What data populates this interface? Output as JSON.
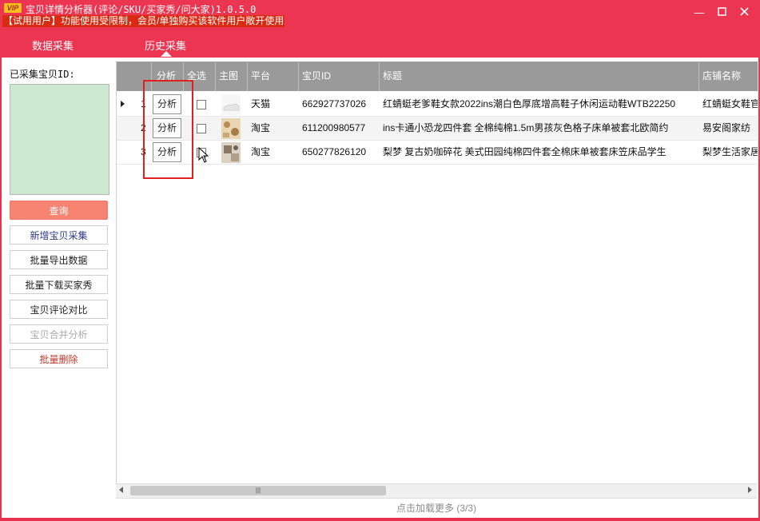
{
  "app": {
    "vip_badge": "VIP",
    "title": "宝贝详情分析器(评论/SKU/买家秀/问大家)1.0.5.0",
    "trial_notice": "【试用用户】功能使用受限制，会员/单独购买该软件用户敞开使用",
    "window_controls": [
      "minimize-icon",
      "maximize-icon",
      "close-icon"
    ]
  },
  "tabs": [
    {
      "label": "数据采集",
      "active": false
    },
    {
      "label": "历史采集",
      "active": true
    }
  ],
  "sidebar": {
    "collected_id_label": "已采集宝贝ID:",
    "buttons": {
      "query": "查询",
      "new_collect": "新增宝贝采集",
      "export": "批量导出数据",
      "download_shows": "批量下载买家秀",
      "compare": "宝贝评论对比",
      "merge": "宝贝合并分析",
      "delete": "批量删除"
    }
  },
  "table": {
    "columns": [
      "分析",
      "全选",
      "主图",
      "平台",
      "宝贝ID",
      "标题",
      "店铺名称"
    ],
    "rows": [
      {
        "num": "1",
        "action": "分析",
        "platform": "天猫",
        "id": "662927737026",
        "title": "红蜻蜓老爹鞋女款2022ins潮白色厚底增高鞋子休闲运动鞋WTB22250",
        "shop": "红蜻蜓女鞋官"
      },
      {
        "num": "2",
        "action": "分析",
        "platform": "淘宝",
        "id": "611200980577",
        "title": "ins卡通小恐龙四件套 全棉纯棉1.5m男孩灰色格子床单被套北欧简约",
        "shop": "易安阁家纺"
      },
      {
        "num": "3",
        "action": "分析",
        "platform": "淘宝",
        "id": "650277826120",
        "title": "梨梦 复古奶咖碎花 美式田园纯棉四件套全棉床单被套床笠床品学生",
        "shop": "梨梦生活家居"
      }
    ]
  },
  "load_more": "点击加载更多 (3/3)",
  "colors": {
    "brand": "#ec3551",
    "header_gray": "#9a9a9a",
    "id_box": "#cce8cf",
    "query_button": "#f78471"
  }
}
